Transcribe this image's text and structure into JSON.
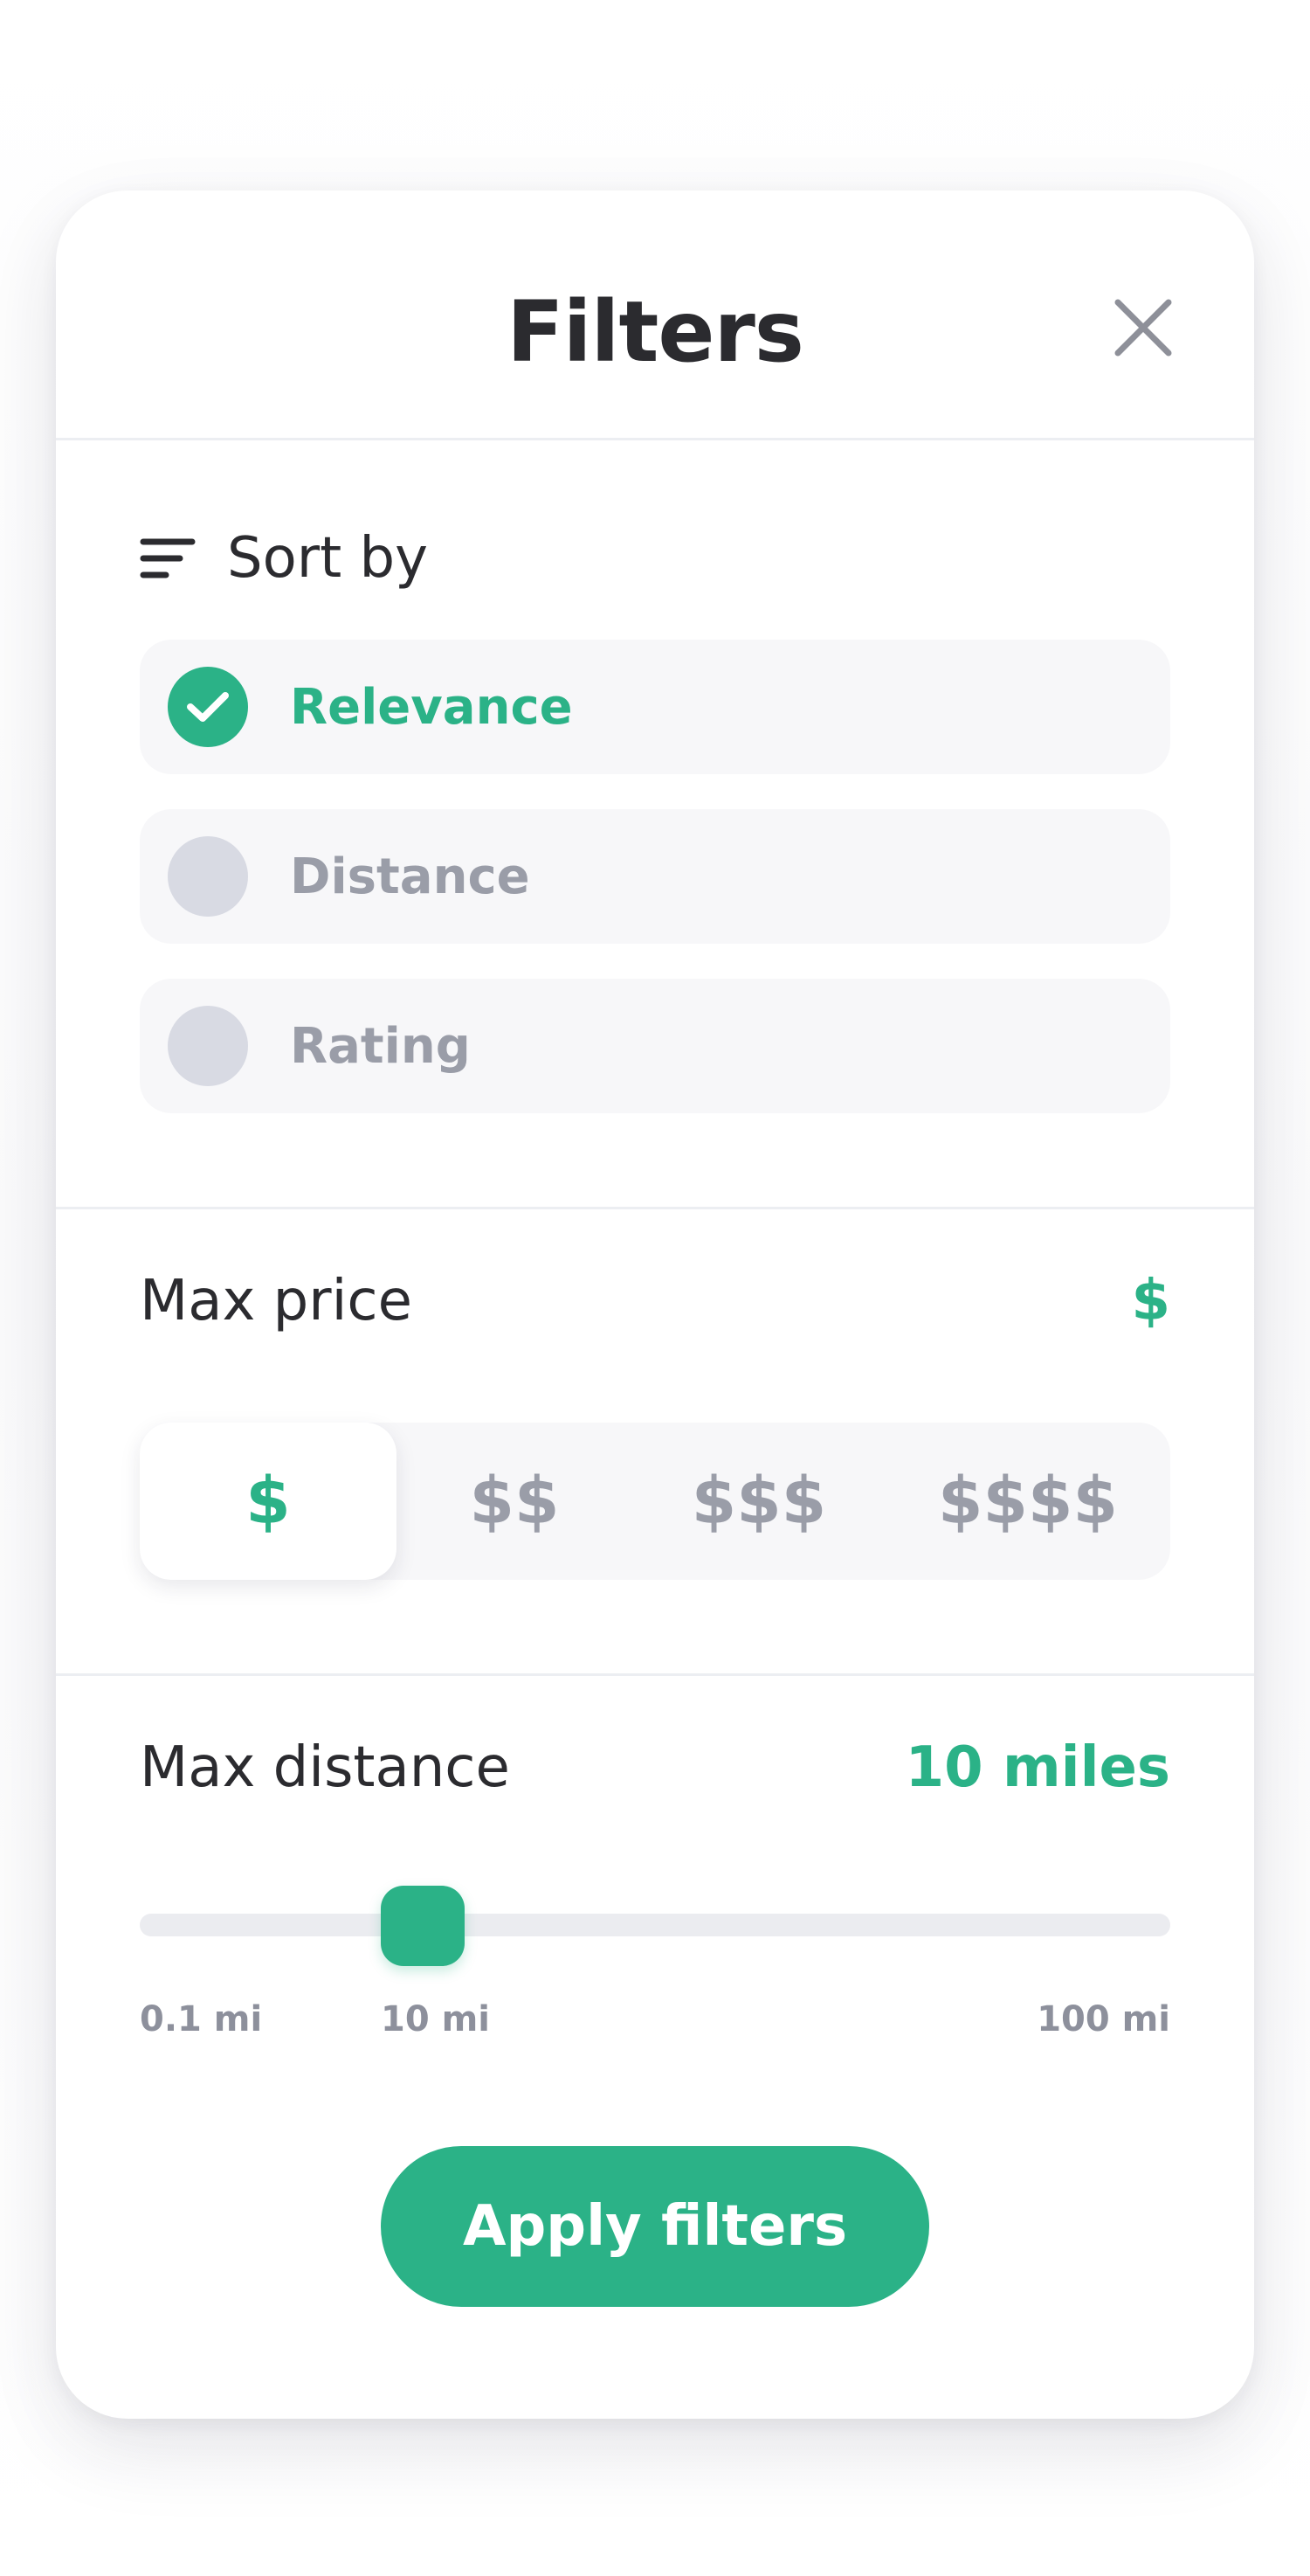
{
  "header": {
    "title": "Filters"
  },
  "sort": {
    "label": "Sort by",
    "options": [
      {
        "label": "Relevance",
        "selected": true
      },
      {
        "label": "Distance",
        "selected": false
      },
      {
        "label": "Rating",
        "selected": false
      }
    ]
  },
  "price": {
    "title": "Max price",
    "current": "$",
    "options": [
      "$",
      "$$",
      "$$$",
      "$$$$"
    ],
    "selected_index": 0
  },
  "distance": {
    "title": "Max distance",
    "current": "10 miles",
    "min_label": "0.1 mi",
    "value_label": "10 mi",
    "max_label": "100 mi"
  },
  "actions": {
    "apply_label": "Apply filters"
  },
  "colors": {
    "accent": "#2bb287",
    "text": "#2b2b2f",
    "muted": "#9a9da8",
    "radio_off": "#d8dae3"
  },
  "icons": {
    "close": "close-icon",
    "sort": "sort-lines-icon",
    "check": "checkmark-icon"
  }
}
